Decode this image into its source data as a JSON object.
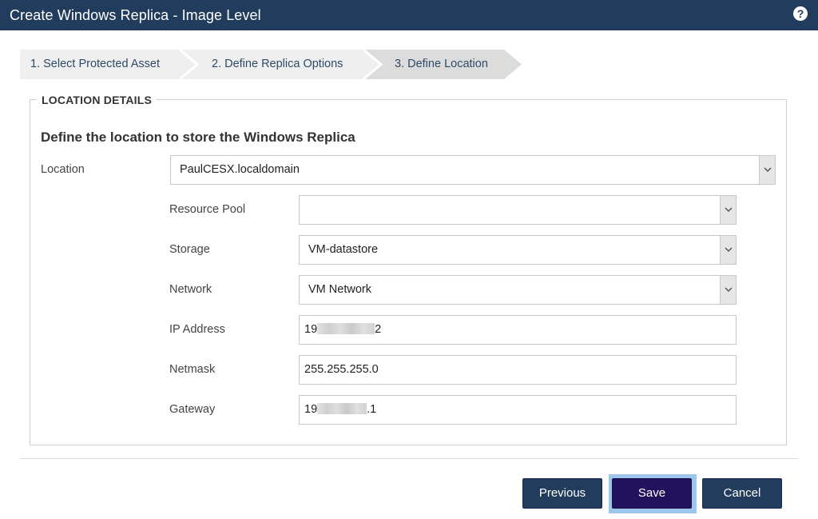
{
  "window": {
    "title": "Create Windows Replica - Image Level",
    "help_icon": "question-circle-icon"
  },
  "wizard": {
    "steps": [
      {
        "label": "1. Select Protected Asset"
      },
      {
        "label": "2. Define Replica Options"
      },
      {
        "label": "3. Define Location"
      }
    ],
    "active_step": 3
  },
  "section": {
    "legend": "LOCATION DETAILS",
    "heading": "Define the location to store the Windows Replica"
  },
  "form": {
    "location": {
      "label": "Location",
      "value": "PaulCESX.localdomain"
    },
    "resource_pool": {
      "label": "Resource Pool",
      "value": ""
    },
    "storage": {
      "label": "Storage",
      "value": "VM-datastore"
    },
    "network": {
      "label": "Network",
      "value": "VM Network"
    },
    "ip_address": {
      "label": "IP Address",
      "prefix": "19",
      "suffix": "2"
    },
    "netmask": {
      "label": "Netmask",
      "value": "255.255.255.0"
    },
    "gateway": {
      "label": "Gateway",
      "prefix": "19",
      "suffix": ".1"
    }
  },
  "buttons": {
    "previous": "Previous",
    "save": "Save",
    "cancel": "Cancel"
  },
  "colors": {
    "header": "#213c5c",
    "button": "#213c5c",
    "save_button": "#22115c",
    "save_focus_ring": "#9dc6ec",
    "step_inactive": "#efefef",
    "step_active": "#dcdcdc"
  }
}
